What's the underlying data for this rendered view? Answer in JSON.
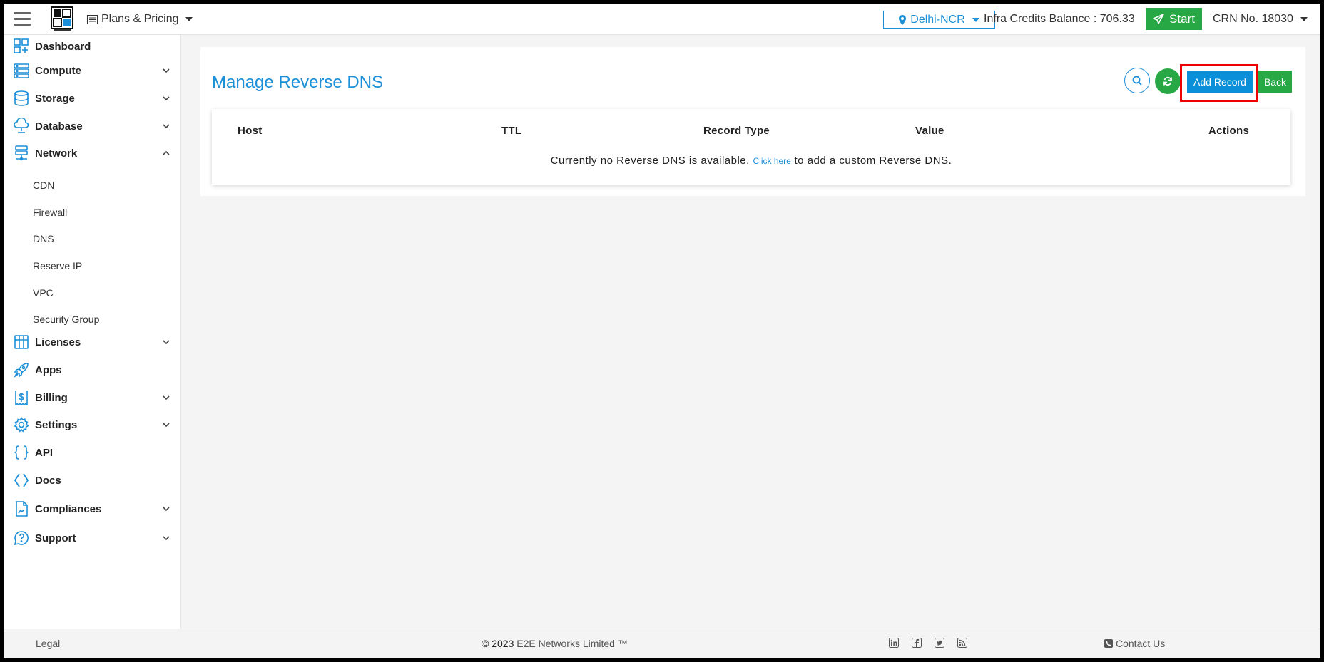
{
  "header": {
    "plans_label": "Plans & Pricing",
    "region_label": "Delhi-NCR",
    "credits_text": "Infra Credits Balance : 706.33",
    "start_label": "Start",
    "crn_label": "CRN No. 18030"
  },
  "sidebar": {
    "items": [
      {
        "label": "Dashboard",
        "icon": "dashboard-icon"
      },
      {
        "label": "Compute",
        "icon": "compute-icon"
      },
      {
        "label": "Storage",
        "icon": "storage-icon"
      },
      {
        "label": "Database",
        "icon": "database-icon"
      },
      {
        "label": "Network",
        "icon": "network-icon"
      },
      {
        "label": "Licenses",
        "icon": "licenses-icon"
      },
      {
        "label": "Apps",
        "icon": "apps-icon"
      },
      {
        "label": "Billing",
        "icon": "billing-icon"
      },
      {
        "label": "Settings",
        "icon": "settings-icon"
      },
      {
        "label": "API",
        "icon": "api-icon"
      },
      {
        "label": "Docs",
        "icon": "docs-icon"
      },
      {
        "label": "Compliances",
        "icon": "compliances-icon"
      },
      {
        "label": "Support",
        "icon": "support-icon"
      }
    ],
    "network_sub": [
      "CDN",
      "Firewall",
      "DNS",
      "Reserve IP",
      "VPC",
      "Security Group"
    ]
  },
  "main": {
    "title": "Manage Reverse DNS",
    "add_label": "Add Record",
    "back_label": "Back",
    "columns": [
      "Host",
      "TTL",
      "Record Type",
      "Value",
      "Actions"
    ],
    "empty_prefix": "Currently no Reverse DNS is available.",
    "empty_link": "Click here",
    "empty_suffix": "to add a custom Reverse DNS."
  },
  "footer": {
    "legal": "Legal",
    "copyright": "© 2023",
    "company": "E2E Networks Limited ™",
    "contact": "Contact Us"
  },
  "colors": {
    "accent": "#1b8fd8",
    "success": "#28a745",
    "highlight": "#e00000"
  }
}
